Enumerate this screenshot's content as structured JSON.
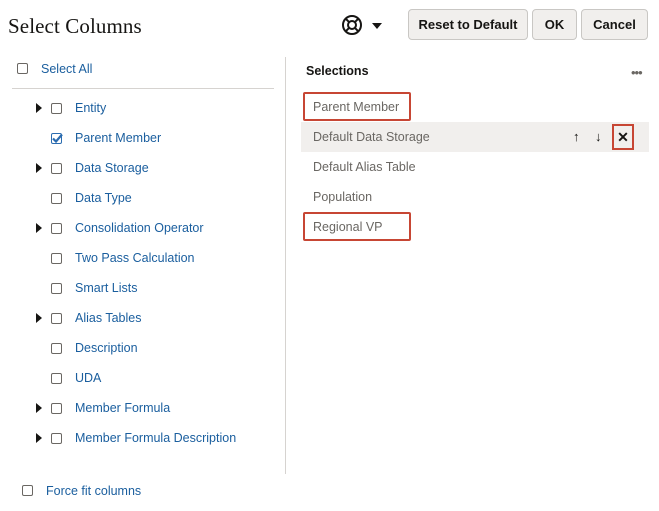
{
  "dialog": {
    "title": "Select Columns"
  },
  "toolbar": {
    "help_icon": "lifebuoy-icon",
    "reset_label": "Reset to Default",
    "ok_label": "OK",
    "cancel_label": "Cancel"
  },
  "select_all": {
    "label": "Select All",
    "checked": false
  },
  "columns": [
    {
      "label": "Entity",
      "checked": false,
      "expandable": true
    },
    {
      "label": "Parent Member",
      "checked": true,
      "expandable": false
    },
    {
      "label": "Data Storage",
      "checked": false,
      "expandable": true
    },
    {
      "label": "Data Type",
      "checked": false,
      "expandable": false
    },
    {
      "label": "Consolidation Operator",
      "checked": false,
      "expandable": true
    },
    {
      "label": "Two Pass Calculation",
      "checked": false,
      "expandable": false
    },
    {
      "label": "Smart Lists",
      "checked": false,
      "expandable": false
    },
    {
      "label": "Alias Tables",
      "checked": false,
      "expandable": true
    },
    {
      "label": "Description",
      "checked": false,
      "expandable": false
    },
    {
      "label": "UDA",
      "checked": false,
      "expandable": false
    },
    {
      "label": "Member Formula",
      "checked": false,
      "expandable": true
    },
    {
      "label": "Member Formula Description",
      "checked": false,
      "expandable": true
    }
  ],
  "force_fit": {
    "label": "Force fit columns",
    "checked": false
  },
  "selections": {
    "heading": "Selections",
    "menu_icon": "more-icon",
    "items": [
      {
        "label": "Parent Member",
        "highlighted": true,
        "active": false
      },
      {
        "label": "Default Data Storage",
        "highlighted": false,
        "active": true
      },
      {
        "label": "Default Alias Table",
        "highlighted": false,
        "active": false
      },
      {
        "label": "Population",
        "highlighted": false,
        "active": false
      },
      {
        "label": "Regional VP",
        "highlighted": true,
        "active": false
      }
    ],
    "move_up_symbol": "↑",
    "move_down_symbol": "↓",
    "remove_symbol": "✕",
    "highlight_color": "#c74634"
  }
}
